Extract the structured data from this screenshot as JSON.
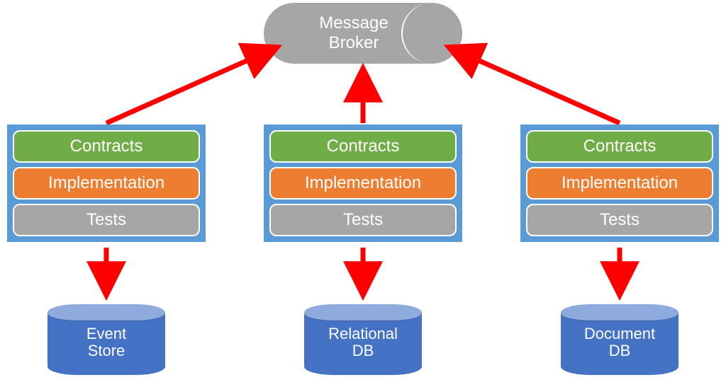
{
  "broker": {
    "line1": "Message",
    "line2": "Broker"
  },
  "services": [
    {
      "id": "svc-left",
      "contracts": "Contracts",
      "implementation": "Implementation",
      "tests": "Tests",
      "db": {
        "line1": "Event",
        "line2": "Store"
      }
    },
    {
      "id": "svc-mid",
      "contracts": "Contracts",
      "implementation": "Implementation",
      "tests": "Tests",
      "db": {
        "line1": "Relational",
        "line2": "DB"
      }
    },
    {
      "id": "svc-right",
      "contracts": "Contracts",
      "implementation": "Implementation",
      "tests": "Tests",
      "db": {
        "line1": "Document",
        "line2": "DB"
      }
    }
  ],
  "colors": {
    "arrow": "#ff0000",
    "service_bg": "#5b9bd5",
    "contracts": "#70ad47",
    "implementation": "#ed7d31",
    "tests": "#a6a6a6",
    "db_body": "#4472c4",
    "db_top": "#8faadc",
    "broker": "#a6a6a6"
  }
}
